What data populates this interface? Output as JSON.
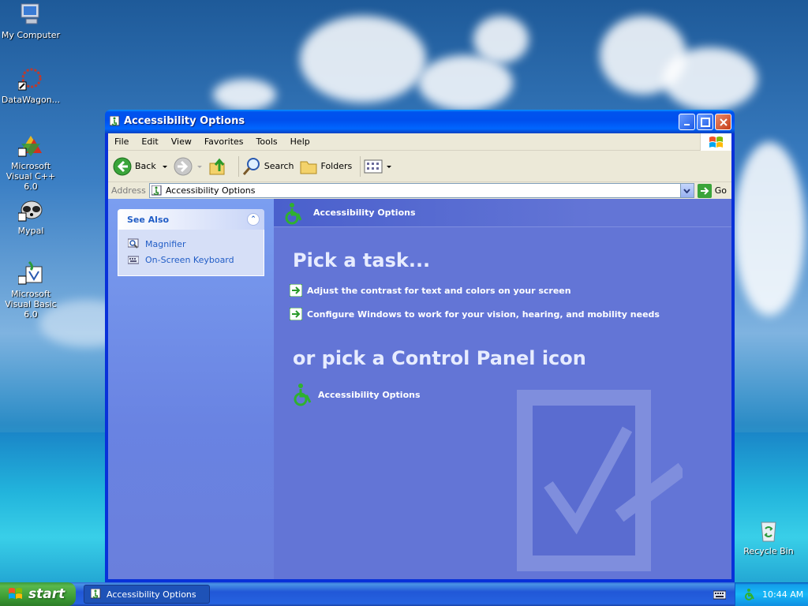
{
  "desktop": {
    "icons": [
      {
        "label": "My Computer"
      },
      {
        "label": "DataWagon..."
      },
      {
        "label": "Microsoft Visual C++ 6.0"
      },
      {
        "label": "Mypal"
      },
      {
        "label": "Microsoft Visual Basic 6.0"
      },
      {
        "label": "Recycle Bin"
      }
    ]
  },
  "window": {
    "title": "Accessibility Options",
    "menu": [
      "File",
      "Edit",
      "View",
      "Favorites",
      "Tools",
      "Help"
    ],
    "toolbar": {
      "back": "Back",
      "search": "Search",
      "folders": "Folders"
    },
    "address": {
      "label": "Address",
      "value": "Accessibility Options",
      "go": "Go"
    },
    "see_also": {
      "title": "See Also",
      "items": [
        {
          "label": "Magnifier"
        },
        {
          "label": "On-Screen Keyboard"
        }
      ]
    },
    "main": {
      "header": "Accessibility Options",
      "pick_task": "Pick a task...",
      "tasks": [
        {
          "label": "Adjust the contrast for text and colors on your screen"
        },
        {
          "label": "Configure Windows to work for your vision, hearing, and mobility needs"
        }
      ],
      "or_pick": "or pick a Control Panel icon",
      "cp_icon": "Accessibility Options"
    }
  },
  "taskbar": {
    "start": "start",
    "task": "Accessibility Options",
    "clock": "10:44 AM"
  },
  "colors": {
    "accent": "#0831d9",
    "pane": "#6375d6",
    "link": "#215dc6"
  }
}
